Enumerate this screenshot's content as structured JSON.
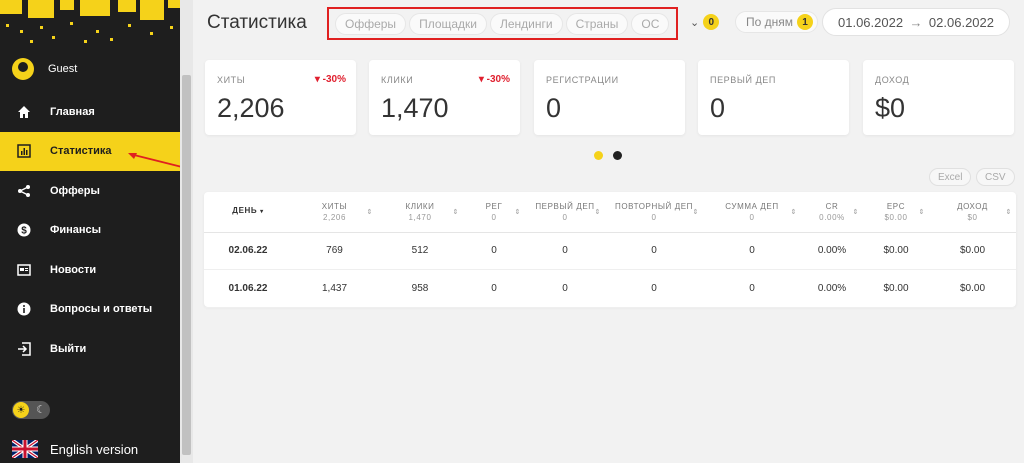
{
  "sidebar": {
    "user": "Guest",
    "items": [
      {
        "label": "Главная",
        "icon": "home-icon"
      },
      {
        "label": "Статистика",
        "icon": "bar-chart-icon"
      },
      {
        "label": "Офферы",
        "icon": "share-icon"
      },
      {
        "label": "Финансы",
        "icon": "dollar-icon"
      },
      {
        "label": "Новости",
        "icon": "news-icon"
      },
      {
        "label": "Вопросы и ответы",
        "icon": "info-icon"
      },
      {
        "label": "Выйти",
        "icon": "logout-icon"
      }
    ],
    "language": "English version"
  },
  "header": {
    "title": "Статистика",
    "filters": [
      "Офферы",
      "Площадки",
      "Лендинги",
      "Страны",
      "ОС"
    ],
    "more_filters_count": "0",
    "group_label": "По дням",
    "group_count": "1",
    "date_from": "01.06.2022",
    "date_to": "02.06.2022"
  },
  "kpis": [
    {
      "label": "ХИТЫ",
      "value": "2,206",
      "delta": "-30%"
    },
    {
      "label": "КЛИКИ",
      "value": "1,470",
      "delta": "-30%"
    },
    {
      "label": "РЕГИСТРАЦИИ",
      "value": "0",
      "delta": ""
    },
    {
      "label": "ПЕРВЫЙ ДЕП",
      "value": "0",
      "delta": ""
    },
    {
      "label": "ДОХОД",
      "value": "$0",
      "delta": ""
    }
  ],
  "export": {
    "excel": "Excel",
    "csv": "CSV"
  },
  "table": {
    "columns": [
      {
        "label": "ДЕНЬ",
        "sub": ""
      },
      {
        "label": "ХИТЫ",
        "sub": "2,206"
      },
      {
        "label": "КЛИКИ",
        "sub": "1,470"
      },
      {
        "label": "РЕГ",
        "sub": "0"
      },
      {
        "label": "ПЕРВЫЙ ДЕП",
        "sub": "0"
      },
      {
        "label": "ПОВТОРНЫЙ ДЕП",
        "sub": "0"
      },
      {
        "label": "СУММА ДЕП",
        "sub": "0"
      },
      {
        "label": "CR",
        "sub": "0.00%"
      },
      {
        "label": "EPC",
        "sub": "$0.00"
      },
      {
        "label": "ДОХОД",
        "sub": "$0"
      }
    ],
    "rows": [
      [
        "02.06.22",
        "769",
        "512",
        "0",
        "0",
        "0",
        "0",
        "0.00%",
        "$0.00",
        "$0.00"
      ],
      [
        "01.06.22",
        "1,437",
        "958",
        "0",
        "0",
        "0",
        "0",
        "0.00%",
        "$0.00",
        "$0.00"
      ]
    ]
  },
  "colors": {
    "accent": "#f5d21a",
    "sidebar_bg": "#1e1e1e",
    "negative": "#e0202f",
    "highlight_border": "#e02020"
  }
}
